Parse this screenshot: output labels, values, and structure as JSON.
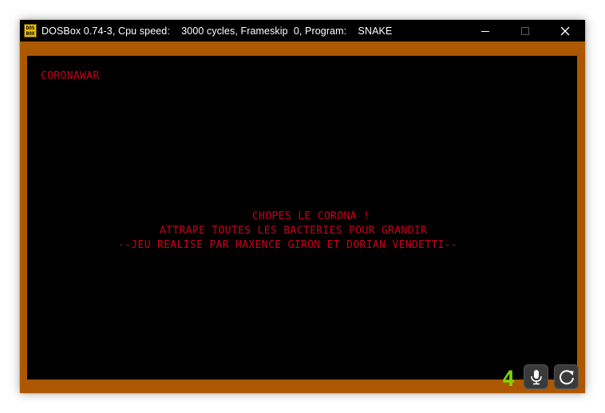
{
  "window": {
    "icon_label": "DOS BOX",
    "title": "DOSBox 0.74-3, Cpu speed:    3000 cycles, Frameskip  0, Program:    SNAKE",
    "controls": {
      "minimize_icon": "minimize-icon",
      "maximize_icon": "maximize-icon",
      "close_icon": "close-icon"
    }
  },
  "game": {
    "header": "CORONAWAR",
    "lines": [
      "CHOPES LE CORONA !",
      "ATTRAPE TOUTES LES BACTERIES POUR GRANDIR",
      "--JEU REALISE PAR MAXENCE GIRON ET DORIAN VENDETTI--"
    ]
  },
  "overlay": {
    "counter": "4",
    "mic_icon": "microphone-icon",
    "refresh_icon": "refresh-icon"
  },
  "colors": {
    "border": "#ac5800",
    "dos_text": "#c8001a",
    "screen": "#000000",
    "counter": "#7fd400"
  }
}
